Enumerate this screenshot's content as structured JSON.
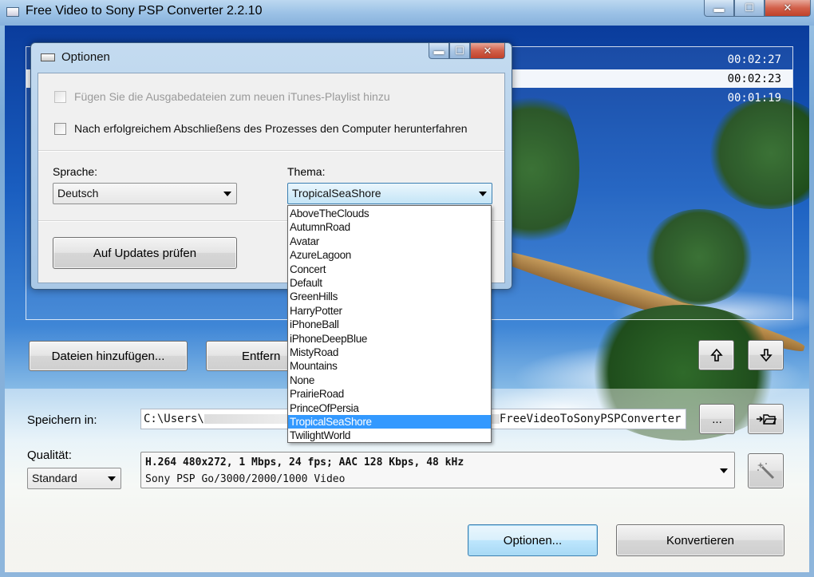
{
  "window": {
    "title": "Free Video to Sony PSP Converter 2.2.10",
    "minimize_glyph": "▬",
    "maximize_glyph": "☐",
    "close_glyph": "✕"
  },
  "file_list": {
    "durations": [
      "00:02:27",
      "00:02:23",
      "00:01:19"
    ],
    "selected_index": 1
  },
  "toolbar": {
    "add_files_label": "Dateien hinzufügen...",
    "remove_label": "Entfern",
    "move_up_icon": "arrow-up-icon",
    "move_down_icon": "arrow-down-icon"
  },
  "save": {
    "label": "Speichern in:",
    "path_start": "C:\\Users\\",
    "path_end": "FreeVideoToSonyPSPConverter",
    "browse_label": "...",
    "open_folder_icon": "open-folder-icon"
  },
  "quality": {
    "label": "Qualität:",
    "preset": "Standard",
    "line1": "H.264 480x272, 1 Mbps, 24 fps; AAC 128 Kbps, 48 kHz",
    "line2": "Sony PSP Go/3000/2000/1000 Video",
    "wizard_icon": "magic-wand-icon"
  },
  "footer": {
    "options_label": "Optionen...",
    "convert_label": "Konvertieren"
  },
  "options_dialog": {
    "title": "Optionen",
    "itunes_label": "Fügen Sie die Ausgabedateien zum neuen iTunes-Playlist hinzu",
    "shutdown_label": "Nach erfolgreichem Abschließens des Prozesses den Computer herunterfahren",
    "language_label": "Sprache:",
    "language_value": "Deutsch",
    "theme_label": "Thema:",
    "theme_value": "TropicalSeaShore",
    "updates_label": "Auf Updates prüfen",
    "theme_options": [
      "AboveTheClouds",
      "AutumnRoad",
      "Avatar",
      "AzureLagoon",
      "Concert",
      "Default",
      "GreenHills",
      "HarryPotter",
      "iPhoneBall",
      "iPhoneDeepBlue",
      "MistyRoad",
      "Mountains",
      "None",
      "PrairieRoad",
      "PrinceOfPersia",
      "TropicalSeaShore",
      "TwilightWorld"
    ],
    "theme_selected_index": 15
  },
  "colors": {
    "selection": "#3399ff",
    "focus_border": "#3c7fb1"
  }
}
